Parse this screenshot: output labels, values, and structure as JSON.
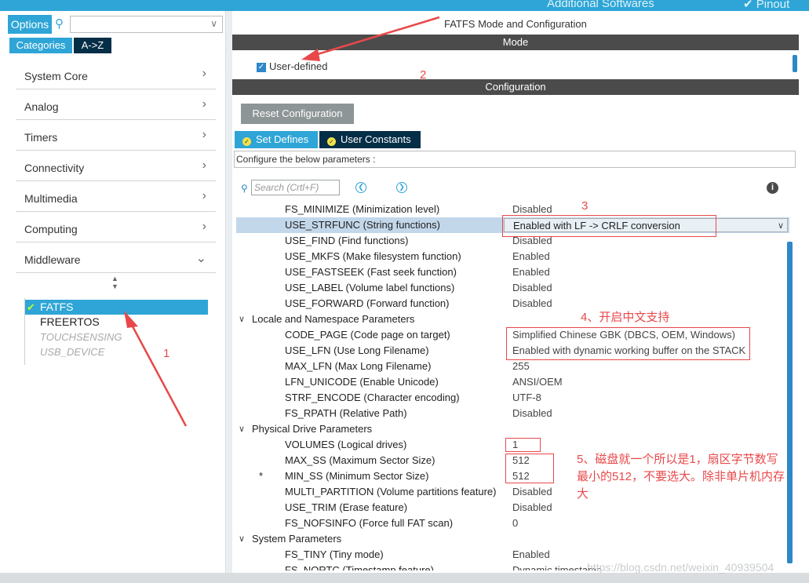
{
  "topbar": {
    "left_text": "Additional Softwares",
    "right_text": "Pinout",
    "chevron": "✔"
  },
  "sidebar": {
    "options_label": "Options",
    "search_value": "",
    "tabs": [
      "Categories",
      "A->Z"
    ],
    "categories": [
      "System Core",
      "Analog",
      "Timers",
      "Connectivity",
      "Multimedia",
      "Computing",
      "Middleware"
    ],
    "middleware_items": [
      {
        "label": "FATFS",
        "state": "selected"
      },
      {
        "label": "FREERTOS",
        "state": "normal"
      },
      {
        "label": "TOUCHSENSING",
        "state": "disabled"
      },
      {
        "label": "USB_DEVICE",
        "state": "disabled"
      }
    ]
  },
  "main": {
    "title": "FATFS Mode and Configuration",
    "mode_header": "Mode",
    "user_defined_label": "User-defined",
    "user_defined_checked": true,
    "config_header": "Configuration",
    "reset_button": "Reset Configuration",
    "tabs": [
      "Set Defines",
      "User Constants"
    ],
    "configure_text": "Configure the below parameters :",
    "search_placeholder": "Search (Crtl+F)"
  },
  "params": [
    {
      "kind": "param",
      "name": "FS_MINIMIZE (Minimization level)",
      "value": "Disabled"
    },
    {
      "kind": "param",
      "name": "USE_STRFUNC (String functions)",
      "value": "Enabled with LF -> CRLF conversion",
      "selected": true
    },
    {
      "kind": "param",
      "name": "USE_FIND (Find functions)",
      "value": "Disabled"
    },
    {
      "kind": "param",
      "name": "USE_MKFS (Make filesystem function)",
      "value": "Enabled"
    },
    {
      "kind": "param",
      "name": "USE_FASTSEEK (Fast seek function)",
      "value": "Enabled"
    },
    {
      "kind": "param",
      "name": "USE_LABEL (Volume label functions)",
      "value": "Disabled"
    },
    {
      "kind": "param",
      "name": "USE_FORWARD (Forward function)",
      "value": "Disabled"
    },
    {
      "kind": "group",
      "name": "Locale and Namespace Parameters"
    },
    {
      "kind": "param",
      "name": "CODE_PAGE (Code page on target)",
      "value": "Simplified Chinese GBK (DBCS, OEM, Windows)"
    },
    {
      "kind": "param",
      "name": "USE_LFN (Use Long Filename)",
      "value": "Enabled with dynamic working buffer on the STACK"
    },
    {
      "kind": "param",
      "name": "MAX_LFN (Max Long Filename)",
      "value": "255"
    },
    {
      "kind": "param",
      "name": "LFN_UNICODE (Enable Unicode)",
      "value": "ANSI/OEM"
    },
    {
      "kind": "param",
      "name": "STRF_ENCODE (Character encoding)",
      "value": "UTF-8"
    },
    {
      "kind": "param",
      "name": "FS_RPATH (Relative Path)",
      "value": "Disabled"
    },
    {
      "kind": "group",
      "name": "Physical Drive Parameters"
    },
    {
      "kind": "param",
      "name": "VOLUMES (Logical drives)",
      "value": "1"
    },
    {
      "kind": "param",
      "name": "MAX_SS (Maximum Sector Size)",
      "value": "512"
    },
    {
      "kind": "param",
      "name": "MIN_SS (Minimum Sector Size)",
      "value": "512",
      "star": "*"
    },
    {
      "kind": "param",
      "name": "MULTI_PARTITION (Volume partitions feature)",
      "value": "Disabled"
    },
    {
      "kind": "param",
      "name": "USE_TRIM (Erase feature)",
      "value": "Disabled"
    },
    {
      "kind": "param",
      "name": "FS_NOFSINFO (Force full FAT scan)",
      "value": "0"
    },
    {
      "kind": "group",
      "name": "System Parameters"
    },
    {
      "kind": "param",
      "name": "FS_TINY (Tiny mode)",
      "value": "Enabled"
    },
    {
      "kind": "param",
      "name": "FS_NORTC (Timestamp feature)",
      "value": "Dynamic timestamp"
    }
  ],
  "annotations": {
    "n1": "1",
    "n2": "2",
    "n3": "3",
    "n4": "4、开启中文支持",
    "n5_line1": "5、磁盘就一个所以是1，扇区字节数写",
    "n5_line2": "最小的512，不要选大。除非单片机内存",
    "n5_line3": "大"
  },
  "watermark": "https://blog.csdn.net/weixin_40939504",
  "colors": {
    "accent": "#2ea5d6",
    "dark_tab": "#052e47",
    "header_bar": "#4b4b4b",
    "annotation": "#e8484a",
    "selected_row": "#c3d7ea"
  }
}
